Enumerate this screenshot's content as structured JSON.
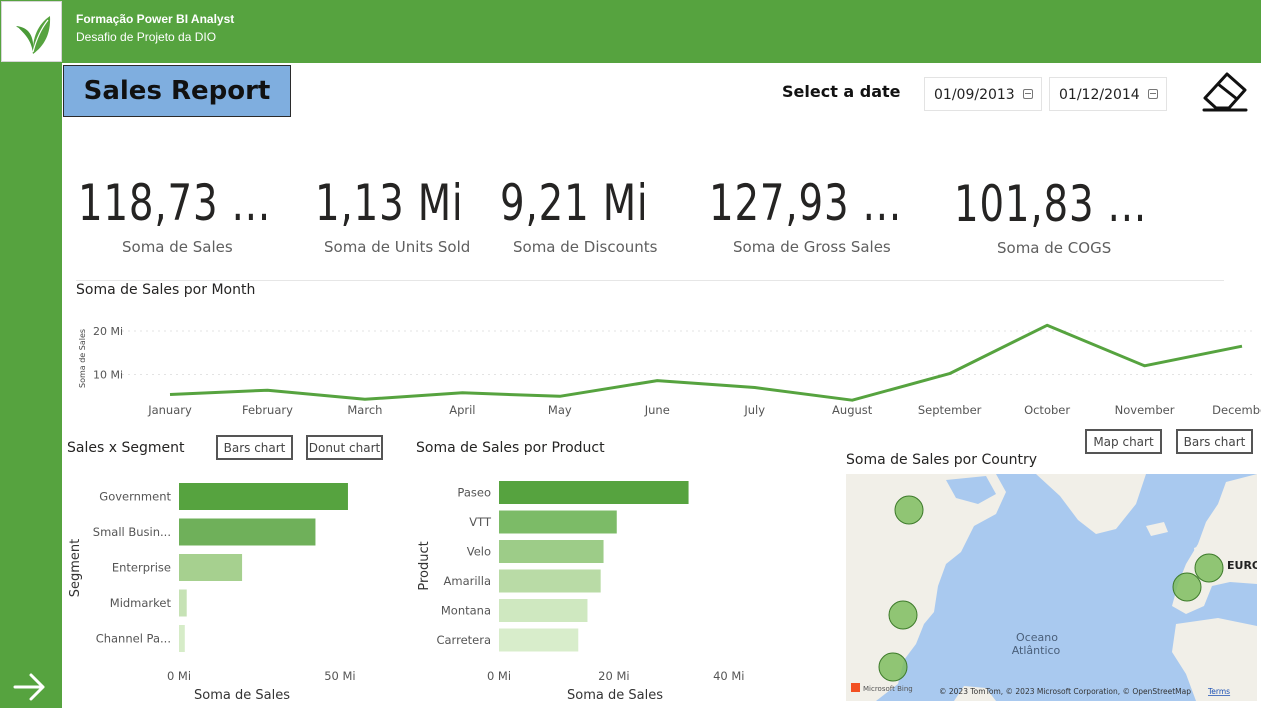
{
  "app": {
    "title": "Formação Power BI Analyst",
    "subtitle": "Desafio de Projeto da DIO",
    "logo_icon": "leaf-icon",
    "nav_icon": "arrow-right-icon",
    "accent_color": "#56a33f"
  },
  "report": {
    "title": "Sales Report",
    "title_bg": "#7faedf"
  },
  "filter": {
    "label": "Select a date",
    "start_date": "01/09/2013",
    "end_date": "01/12/2014",
    "calendar_icon": "calendar-icon",
    "clear_icon": "eraser-icon"
  },
  "kpis": [
    {
      "value": "118,73 ...",
      "label": "Soma de  Sales"
    },
    {
      "value": "1,13 Mi",
      "label": "Soma de Units Sold"
    },
    {
      "value": "9,21 Mi",
      "label": "Soma de Discounts"
    },
    {
      "value": "127,93 ...",
      "label": "Soma de Gross Sales"
    },
    {
      "value": "101,83 ...",
      "label": "Soma de COGS"
    }
  ],
  "line_chart": {
    "title": "Soma de Sales por Month",
    "chart_data": {
      "type": "line",
      "x": [
        "January",
        "February",
        "March",
        "April",
        "May",
        "June",
        "July",
        "August",
        "September",
        "October",
        "November",
        "December"
      ],
      "series": [
        {
          "values": [
            5.4,
            6.4,
            4.3,
            5.8,
            5.0,
            8.6,
            7.0,
            4.1,
            10.2,
            21.3,
            12.0,
            16.5
          ]
        }
      ],
      "ylabel": "Soma de Sales",
      "yticks": [
        "10 Mi",
        "20 Mi"
      ],
      "ylim": [
        0,
        25
      ],
      "color": "#56a33f"
    }
  },
  "segment_chart": {
    "title": "Sales x Segment",
    "buttons": [
      "Bars chart",
      "Donut chart"
    ],
    "chart_data": {
      "type": "bar",
      "orientation": "horizontal",
      "categories": [
        "Government",
        "Small Busin...",
        "Enterprise",
        "Midmarket",
        "Channel Pa..."
      ],
      "values": [
        52.5,
        42.4,
        19.6,
        2.4,
        1.8
      ],
      "xlabel": "Soma de Sales",
      "ylabel": "Segment",
      "xticks": [
        "0 Mi",
        "50 Mi"
      ],
      "xlim": [
        0,
        55
      ],
      "colors": [
        "#56a33f",
        "#6fb05a",
        "#a6d08f",
        "#c6e2b5",
        "#d6ecc8"
      ]
    }
  },
  "product_chart": {
    "title": "Soma de Sales por Product",
    "chart_data": {
      "type": "bar",
      "orientation": "horizontal",
      "categories": [
        "Paseo",
        "VTT",
        "Velo",
        "Amarilla",
        "Montana",
        "Carretera"
      ],
      "values": [
        33.0,
        20.5,
        18.2,
        17.7,
        15.4,
        13.8
      ],
      "xlabel": "Soma de Sales",
      "ylabel": "Product",
      "xticks": [
        "0 Mi",
        "20 Mi",
        "40 Mi"
      ],
      "xlim": [
        0,
        43
      ],
      "colors": [
        "#56a33f",
        "#7cbb67",
        "#9dcc88",
        "#b9dba6",
        "#cfe8c0",
        "#d8edcb"
      ]
    }
  },
  "map_chart": {
    "title": "Soma de Sales por Country",
    "buttons": [
      "Map chart",
      "Bars chart"
    ],
    "ocean_label": "Oceano Atlântico",
    "ocean_line1": "Oceano",
    "ocean_line2": "Atlântico",
    "region_label": "EURO",
    "attribution": "© 2023 TomTom, © 2023 Microsoft Corporation, © OpenStreetMap",
    "terms": "Terms",
    "bing_label": "Microsoft Bing",
    "water_color": "#a9c9ef",
    "land_color": "#f1efe8",
    "bubble_color": "#7fbd5f"
  }
}
